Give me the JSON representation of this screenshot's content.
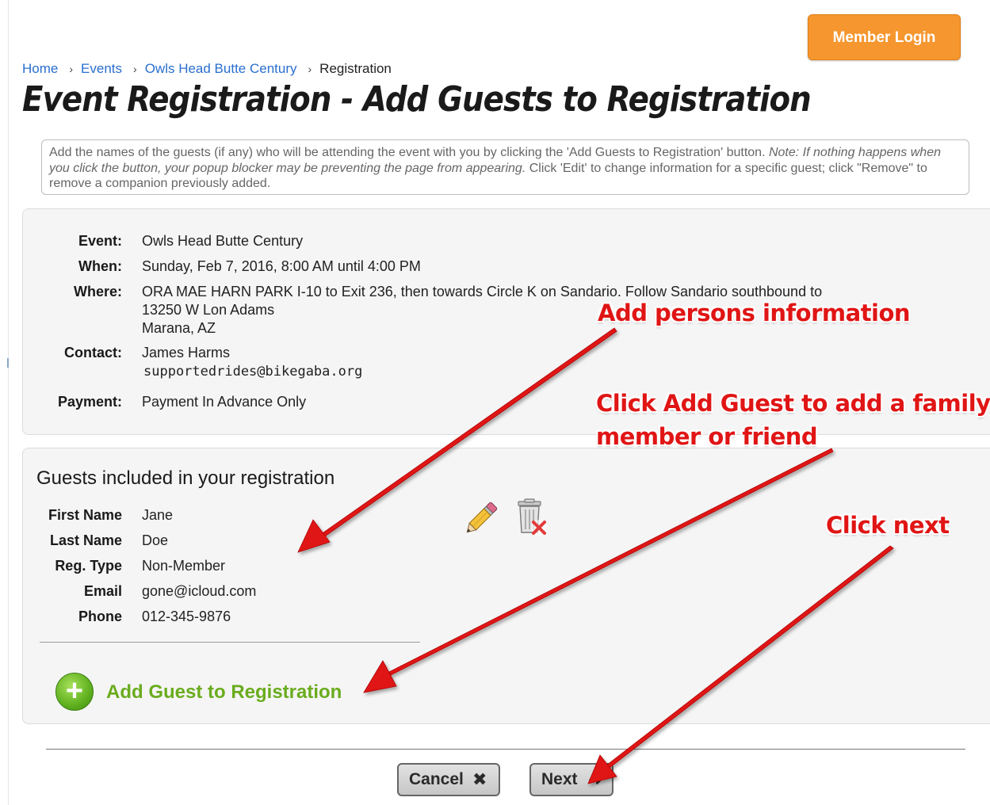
{
  "header": {
    "member_login": "Member Login"
  },
  "breadcrumb": {
    "items": [
      "Home",
      "Events",
      "Owls Head Butte Century"
    ],
    "current": "Registration"
  },
  "page_title": "Event Registration - Add Guests to Registration",
  "instructions": {
    "text_1": "Add the names of the guests (if any) who will be attending the event with you by clicking the 'Add Guests to Registration' button. ",
    "note": "Note: If nothing happens when you click the button, your popup blocker may be preventing the page from appearing.",
    "text_2": " Click 'Edit' to change information for a specific guest; click \"Remove\" to remove a companion previously added."
  },
  "event": {
    "event_label": "Event:",
    "event_value": "Owls Head Butte Century",
    "when_label": "When:",
    "when_value": "Sunday, Feb 7, 2016, 8:00 AM until 4:00 PM",
    "where_label": "Where:",
    "where_lines": [
      "ORA MAE HARN PARK I-10 to Exit 236, then towards Circle K on Sandario. Follow Sandario southbound to",
      "13250 W Lon Adams",
      "Marana, AZ"
    ],
    "contact_label": "Contact:",
    "contact_name": "James Harms",
    "contact_email": "supportedrides@bikegaba.org",
    "payment_label": "Payment:",
    "payment_value": "Payment In Advance Only"
  },
  "guests": {
    "heading": "Guests included in your registration",
    "fields": [
      {
        "label": "First Name",
        "value": "Jane"
      },
      {
        "label": "Last Name",
        "value": "Doe"
      },
      {
        "label": "Reg. Type",
        "value": "Non-Member"
      },
      {
        "label": "Email",
        "value": "gone@icloud.com"
      },
      {
        "label": "Phone",
        "value": "012-345-9876"
      }
    ],
    "add_label": "Add Guest to Registration"
  },
  "buttons": {
    "cancel": "Cancel",
    "next": "Next"
  },
  "annotations": {
    "persons": "Add persons information",
    "add_guest_line1": "Click Add Guest to add a family",
    "add_guest_line2": "member or friend",
    "next": "Click next"
  },
  "colors": {
    "member_login_bg": "#f5962e",
    "link": "#2a6fcf",
    "add_guest_green": "#6aac1e",
    "annotation_red": "#e01515"
  }
}
